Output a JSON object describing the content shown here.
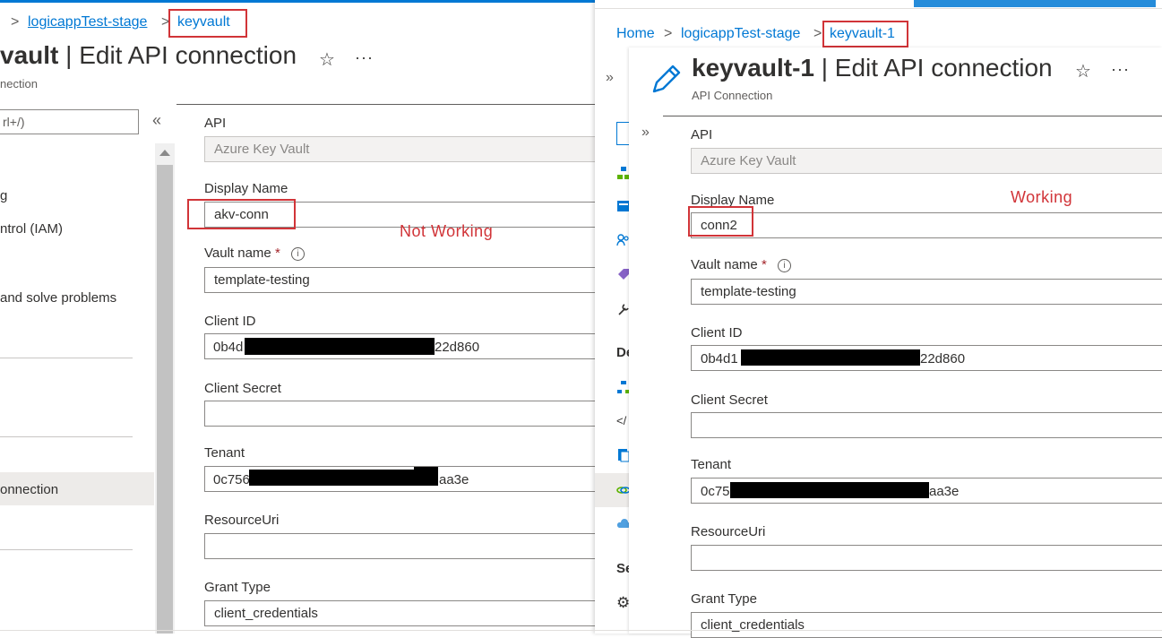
{
  "left": {
    "breadcrumb": [
      {
        "sep": ">",
        "label": "logicappTest-stage"
      },
      {
        "sep": ">",
        "label": "keyvault"
      }
    ],
    "title_name": "vault",
    "title_rest": "| Edit API connection",
    "subtitle": "nection",
    "search_placeholder": "rl+/)",
    "collapse_icon": "«",
    "nav": [
      "g",
      "ntrol (IAM)",
      "and solve problems",
      "onnection"
    ],
    "form": {
      "api_label": "API",
      "api_value": "Azure Key Vault",
      "display_name_label": "Display Name",
      "display_name_value": "akv-conn",
      "vault_name_label": "Vault name",
      "required_mark": "*",
      "vault_name_value": "template-testing",
      "client_id_label": "Client ID",
      "client_id_prefix": "0b4d",
      "client_id_suffix": "22d860",
      "client_secret_label": "Client Secret",
      "client_secret_value": "",
      "tenant_label": "Tenant",
      "tenant_prefix": "0c756",
      "tenant_suffix": "aa3e",
      "resource_uri_label": "ResourceUri",
      "resource_uri_value": "",
      "grant_type_label": "Grant Type",
      "grant_type_value": "client_credentials"
    },
    "annotation": "Not Working"
  },
  "right": {
    "breadcrumb": [
      {
        "sep": "",
        "label": "Home"
      },
      {
        "sep": ">",
        "label": "logicappTest-stage"
      },
      {
        "sep": ">",
        "label": "keyvault-1"
      }
    ],
    "title_name": "keyvault-1",
    "title_rest": "| Edit API connection",
    "subtitle": "API Connection",
    "expand_icon": "»",
    "nav_fragments": [
      "De",
      "Se"
    ],
    "form": {
      "api_label": "API",
      "api_value": "Azure Key Vault",
      "display_name_label": "Display Name",
      "display_name_value": "conn2",
      "vault_name_label": "Vault name",
      "required_mark": "*",
      "vault_name_value": "template-testing",
      "client_id_label": "Client ID",
      "client_id_prefix": "0b4d1",
      "client_id_suffix": "22d860",
      "client_secret_label": "Client Secret",
      "client_secret_value": "",
      "tenant_label": "Tenant",
      "tenant_prefix": "0c75",
      "tenant_suffix": "aa3e",
      "resource_uri_label": "ResourceUri",
      "resource_uri_value": "",
      "grant_type_label": "Grant Type",
      "grant_type_value": "client_credentials"
    },
    "annotation": "Working"
  },
  "icons": {
    "star": "☆",
    "more": "···",
    "info": "i",
    "chevron": ">"
  },
  "colors": {
    "azure_blue": "#0078d4",
    "annotation_red": "#d13438",
    "required_red": "#a4262c",
    "border": "#8a8886"
  }
}
